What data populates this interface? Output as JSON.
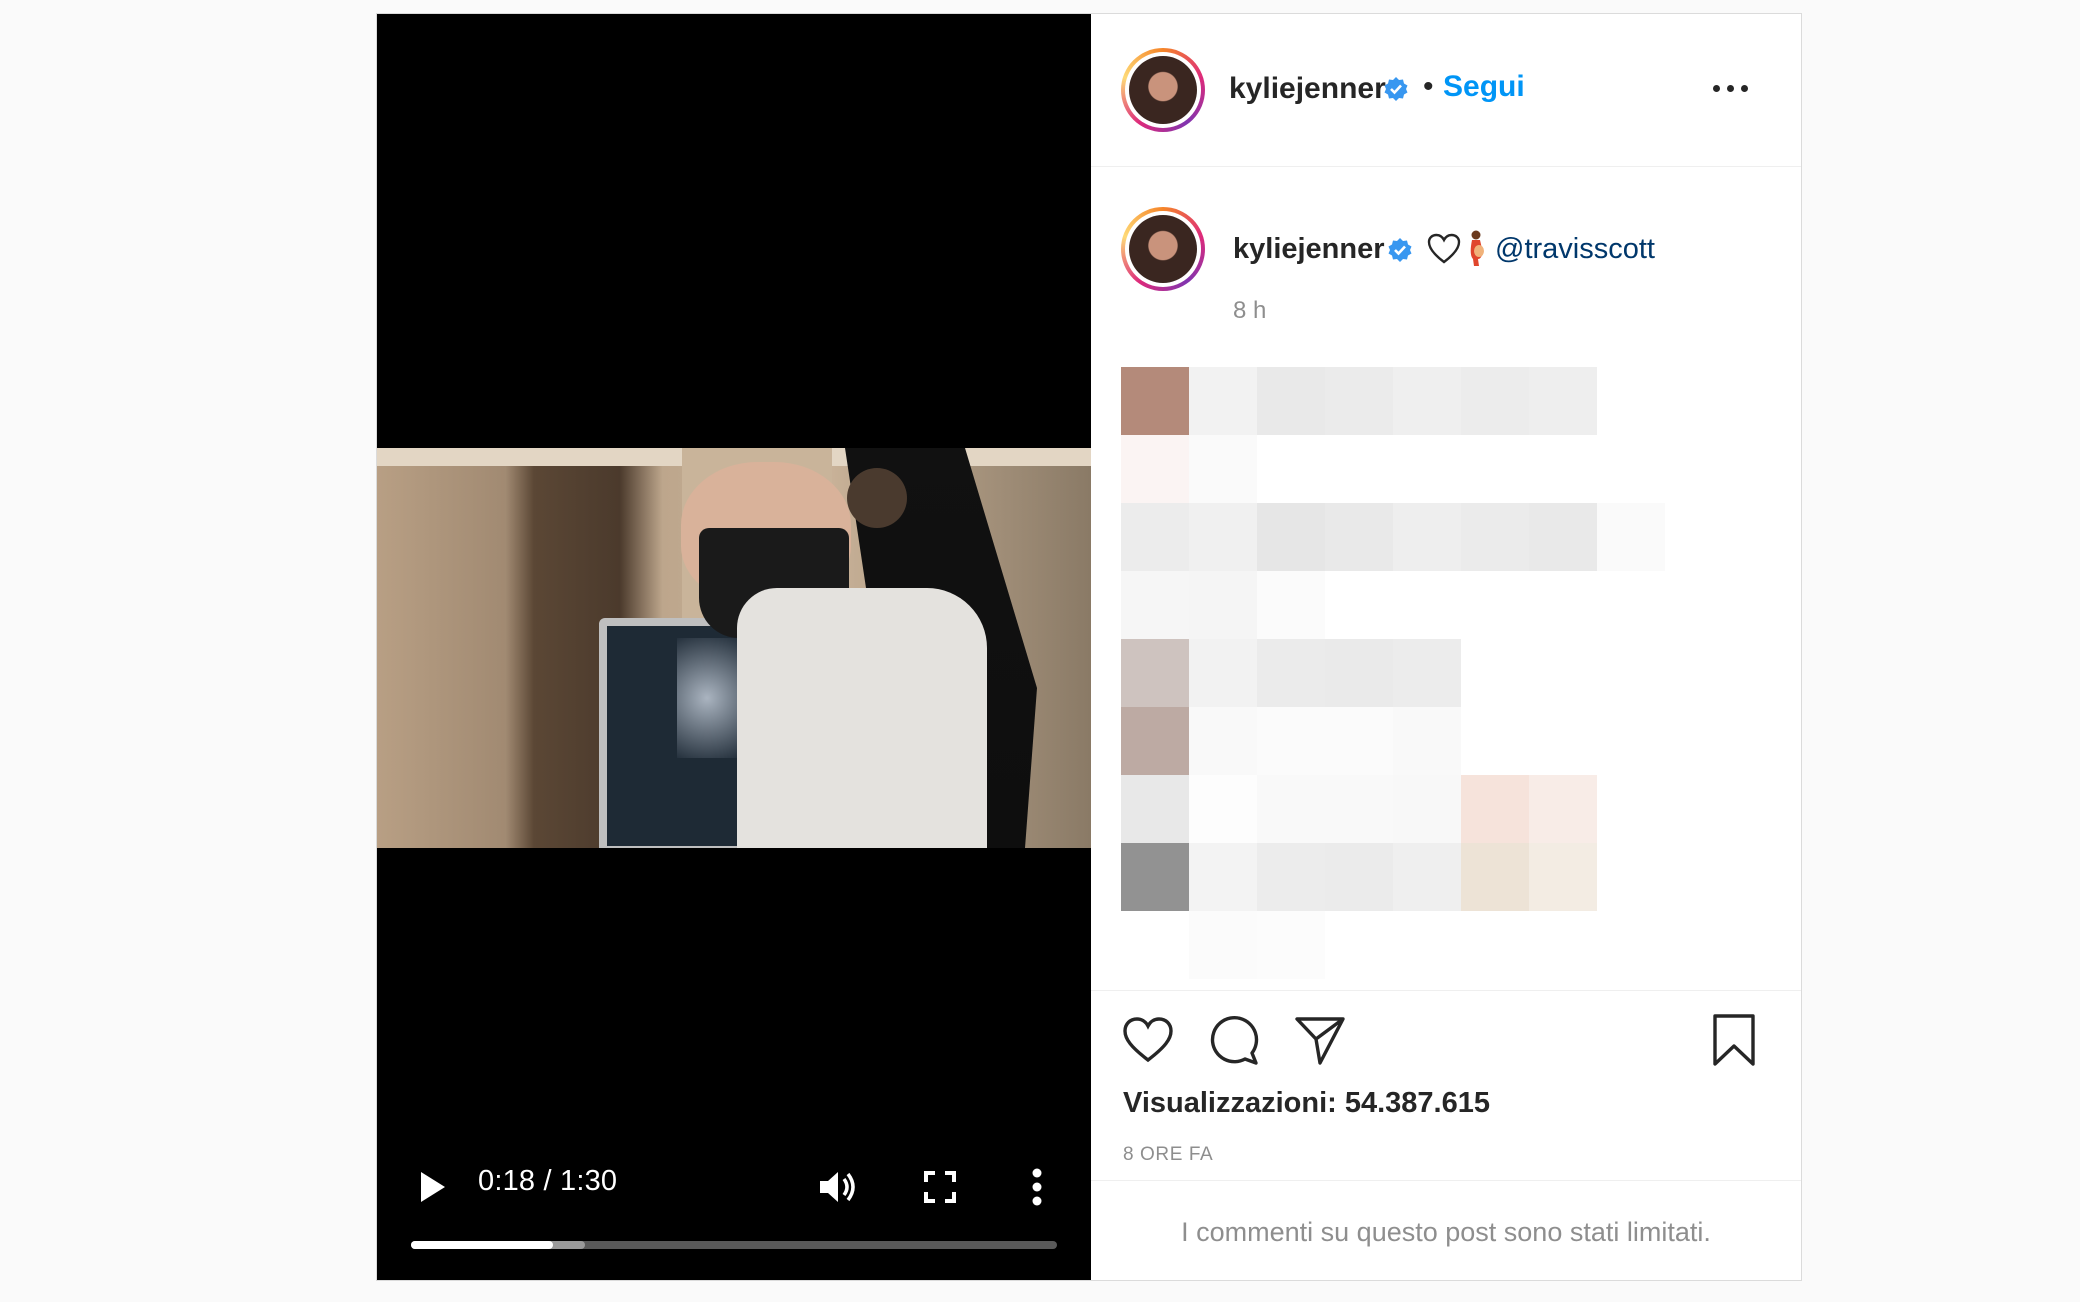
{
  "post": {
    "username": "kyliejenner",
    "follow_label": "Segui",
    "separator": "•",
    "mention": "@travisscott",
    "post_age": "8 h",
    "views": "Visualizzazioni: 54.387.615",
    "time_ago": "8 ORE FA",
    "comments_limited": "I commenti su questo post sono stati limitati."
  },
  "video": {
    "time": "0:18 / 1:30",
    "progress": 0.22,
    "buffered": 0.27
  },
  "icons": {
    "verified": "verified-badge-icon",
    "options": "more-options-icon",
    "like": "heart-icon",
    "comment": "comment-bubble-icon",
    "share": "paper-plane-icon",
    "save": "bookmark-icon",
    "play": "play-icon",
    "volume": "volume-icon",
    "fullscreen": "fullscreen-icon",
    "video_menu": "vertical-dots-icon"
  },
  "colors": {
    "link_blue": "#0095f6",
    "mention": "#00376b",
    "verified_blue": "#3897f0",
    "muted_text": "#8e8e8e"
  }
}
